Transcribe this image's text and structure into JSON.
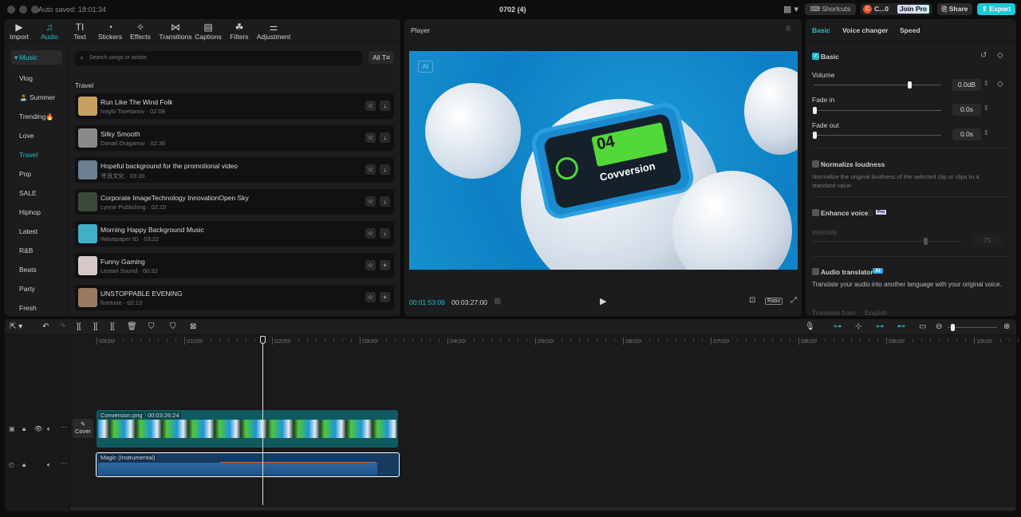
{
  "titlebar": {
    "autosave": "Auto saved: 18:01:34",
    "project": "0702 (4)",
    "shortcuts": "Shortcuts",
    "user": "C...0",
    "user_initial": "C",
    "join_pro": "Join Pro",
    "share": "Share",
    "export": "Export"
  },
  "media_tabs": [
    {
      "label": "Import",
      "icon": "▶"
    },
    {
      "label": "Audio",
      "icon": "♫"
    },
    {
      "label": "Text",
      "icon": "TI"
    },
    {
      "label": "Stickers",
      "icon": "◔"
    },
    {
      "label": "Effects",
      "icon": "✧"
    },
    {
      "label": "Transitions",
      "icon": "⋈"
    },
    {
      "label": "Captions",
      "icon": "▤"
    },
    {
      "label": "Filters",
      "icon": "☘"
    },
    {
      "label": "Adjustment",
      "icon": "⚌"
    }
  ],
  "categories": [
    "Music",
    "Vlog",
    "🏝️ Summer",
    "Trending🔥",
    "Love",
    "Travel",
    "Pop",
    "SALE",
    "Hiphop",
    "Latest",
    "R&B",
    "Beats",
    "Party",
    "Fresh"
  ],
  "search": {
    "placeholder": "Search songs or artists",
    "filter": "All"
  },
  "section_title": "Travel",
  "songs": [
    {
      "title": "Run Like The Wind Folk",
      "artist": "Ivaylo Tsvetanov",
      "duration": "02:08",
      "color": "#c8a060",
      "action": "↓"
    },
    {
      "title": "Silky Smooth",
      "artist": "Danail Draganov",
      "duration": "02:36",
      "color": "#8a8a8a",
      "action": "↓"
    },
    {
      "title": "Hopeful background for the promotional video",
      "artist": "寻浪文化",
      "duration": "03:30",
      "color": "#6b8090",
      "action": "↓"
    },
    {
      "title": "Corporate ImageTechnology InnovationOpen Sky",
      "artist": "Lynne Publishing",
      "duration": "02:15",
      "color": "#3a4a3a",
      "action": "↓"
    },
    {
      "title": "Morning Happy Background Music",
      "artist": "Wavepaper ID",
      "duration": "03:22",
      "color": "#40b0c8",
      "action": "↓"
    },
    {
      "title": "Funny Gaming",
      "artist": "Lestari Sound",
      "duration": "00:32",
      "color": "#d8c8c8",
      "action": "+"
    },
    {
      "title": "UNSTOPPABLE EVENING",
      "artist": "finetune",
      "duration": "02:13",
      "color": "#9a7a60",
      "action": "+"
    }
  ],
  "player": {
    "title": "Player",
    "current": "00:01:53:09",
    "total": "00:03:27:00",
    "ratio": "Ratio",
    "ai_badge": "AI",
    "screen_number": "04",
    "screen_text": "Covversion"
  },
  "inspector": {
    "tabs": [
      "Basic",
      "Voice changer",
      "Speed"
    ],
    "basic": "Basic",
    "volume": "Volume",
    "volume_value": "0.0dB",
    "volume_level": 0.83,
    "fade_in": "Fade in",
    "fade_in_value": "0.0s",
    "fade_out": "Fade out",
    "fade_out_value": "0.0s",
    "normalize": "Normalize loudness",
    "normalize_desc": "Normalize the original loudness of the selected clip or clips to a standard value",
    "enhance": "Enhance voice",
    "pro_badge": "Pro",
    "intensity": "Intensity",
    "intensity_value": "75",
    "translator": "Audio translator",
    "ai_badge": "AI",
    "translator_desc": "Translate your audio into another language with your original voice.",
    "translate_from": "Translate from",
    "language": "English"
  },
  "timeline": {
    "ruler": [
      "00:00",
      "01:00",
      "02:00",
      "03:00",
      "04:00",
      "05:00",
      "06:00",
      "07:00",
      "08:00",
      "09:00",
      "10:00"
    ],
    "video_clip": {
      "name": "Conversion.png",
      "duration": "00:03:26:24"
    },
    "cover": "Cover",
    "audio_clip": {
      "name": "Magic (Instrumental)"
    }
  },
  "colors": {
    "accent": "#22c0d0",
    "export": "#1fc8d8",
    "video_track": "#0e5a60",
    "audio_track": "#163a60"
  }
}
